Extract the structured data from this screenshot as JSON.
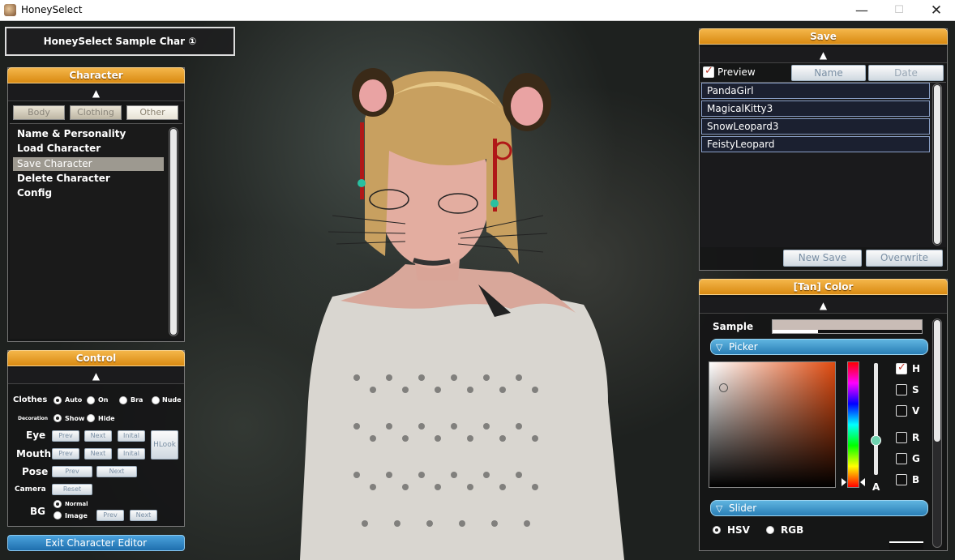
{
  "window": {
    "title": "HoneySelect",
    "minimize": "—",
    "maximize": "☐",
    "close": "✕"
  },
  "header_tab": {
    "label": "HoneySelect Sample Char ①"
  },
  "character_panel": {
    "title": "Character",
    "up_arrow": "▲",
    "tabs": [
      {
        "label": "Body",
        "active": false
      },
      {
        "label": "Clothing",
        "active": false
      },
      {
        "label": "Other",
        "active": true
      }
    ],
    "items": [
      {
        "label": "Name & Personality",
        "selected": false
      },
      {
        "label": "Load Character",
        "selected": false
      },
      {
        "label": "Save Character",
        "selected": true
      },
      {
        "label": "Delete Character",
        "selected": false
      },
      {
        "label": "Config",
        "selected": false
      }
    ]
  },
  "control_panel": {
    "title": "Control",
    "up_arrow": "▲",
    "clothes": {
      "label": "Clothes",
      "options": [
        "Auto",
        "On",
        "Bra",
        "Nude"
      ],
      "selected": "Auto"
    },
    "decoration": {
      "label": "Decoration",
      "options": [
        "Show",
        "Hide"
      ],
      "selected": "Show"
    },
    "eye": {
      "label": "Eye",
      "prev": "Prev",
      "next": "Next",
      "initial": "Inital"
    },
    "mouth": {
      "label": "Mouth",
      "prev": "Prev",
      "next": "Next",
      "initial": "Inital"
    },
    "hlook": "HLook",
    "pose": {
      "label": "Pose",
      "prev": "Prev",
      "next": "Next"
    },
    "camera": {
      "label": "Camera",
      "reset": "Reset"
    },
    "bg": {
      "label": "BG",
      "options": [
        "Normal",
        "Image"
      ],
      "selected": "Normal",
      "prev": "Prev",
      "next": "Next"
    }
  },
  "exit_button": "Exit Character Editor",
  "save_panel": {
    "title": "Save",
    "up_arrow": "▲",
    "preview_label": "Preview",
    "preview_checked": true,
    "sort_name": "Name",
    "sort_date": "Date",
    "files": [
      "PandaGirl",
      "MagicalKitty3",
      "SnowLeopard3",
      "FeistyLeopard"
    ],
    "new_save": "New Save",
    "overwrite": "Overwrite"
  },
  "color_panel": {
    "title": "[Tan] Color",
    "up_arrow": "▲",
    "sample_label": "Sample",
    "picker_label": "Picker",
    "slider_label": "Slider",
    "collapse_icon": "▽",
    "channels": [
      {
        "label": "H",
        "checked": true
      },
      {
        "label": "S",
        "checked": false
      },
      {
        "label": "V",
        "checked": false
      },
      {
        "label": "R",
        "checked": false
      },
      {
        "label": "G",
        "checked": false
      },
      {
        "label": "B",
        "checked": false
      }
    ],
    "alpha_label": "A",
    "modes": [
      {
        "label": "HSV",
        "selected": true
      },
      {
        "label": "RGB",
        "selected": false
      }
    ],
    "colors": {
      "hue_base": "#e04b10",
      "sample": "#c9bcb6"
    }
  },
  "colors": {
    "accent_orange": "#e89a22",
    "accent_blue": "#3b93c8"
  }
}
